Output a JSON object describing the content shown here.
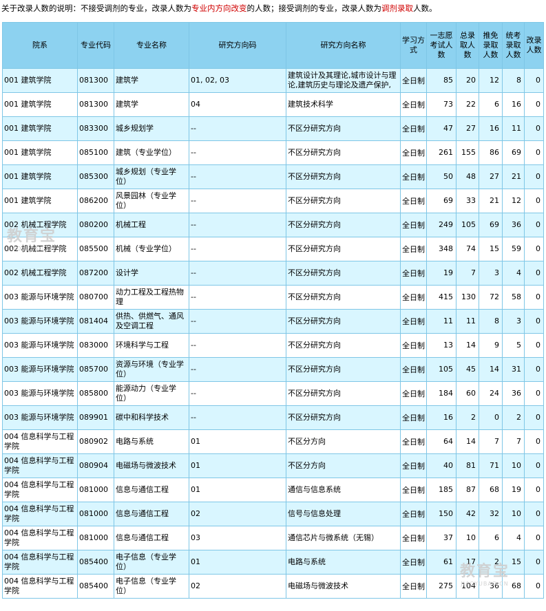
{
  "note": {
    "part1": "关于改录人数的说明：不接受调剂的专业，改录人数为",
    "red1": "专业内方向改变",
    "part2": "的人数；接受调剂的专业，改录人数为",
    "red2": "调剂录取",
    "part3": "人数。",
    "red_color": "#d00000"
  },
  "headers": [
    "院系",
    "专业代码",
    "专业名称",
    "研究方向码",
    "研究方向名称",
    "学习方式",
    "一志愿考试人数",
    "总录取人数",
    "推免录取人数",
    "统考录取人数",
    "改录人数"
  ],
  "rows": [
    [
      "001 建筑学院",
      "081300",
      "建筑学",
      "01, 02, 03",
      "建筑设计及其理论,城市设计与理论,建筑历史与理论及遗产保护,",
      "全日制",
      "85",
      "20",
      "12",
      "8",
      "0"
    ],
    [
      "001 建筑学院",
      "081300",
      "建筑学",
      "04",
      "建筑技术科学",
      "全日制",
      "73",
      "22",
      "6",
      "16",
      "0"
    ],
    [
      "001 建筑学院",
      "083300",
      "城乡规划学",
      "--",
      "不区分研究方向",
      "全日制",
      "47",
      "27",
      "16",
      "11",
      "0"
    ],
    [
      "001 建筑学院",
      "085100",
      "建筑（专业学位）",
      "--",
      "不区分研究方向",
      "全日制",
      "261",
      "155",
      "86",
      "69",
      "0"
    ],
    [
      "001 建筑学院",
      "085300",
      "城乡规划（专业学位）",
      "--",
      "不区分研究方向",
      "全日制",
      "50",
      "48",
      "27",
      "21",
      "0"
    ],
    [
      "001 建筑学院",
      "086200",
      "风景园林（专业学位）",
      "--",
      "不区分研究方向",
      "全日制",
      "69",
      "33",
      "21",
      "12",
      "0"
    ],
    [
      "002 机械工程学院",
      "080200",
      "机械工程",
      "--",
      "不区分研究方向",
      "全日制",
      "249",
      "105",
      "69",
      "36",
      "0"
    ],
    [
      "002 机械工程学院",
      "085500",
      "机械（专业学位）",
      "--",
      "不区分研究方向",
      "全日制",
      "348",
      "74",
      "15",
      "59",
      "0"
    ],
    [
      "002 机械工程学院",
      "087200",
      "设计学",
      "--",
      "不区分研究方向",
      "全日制",
      "19",
      "7",
      "3",
      "4",
      "0"
    ],
    [
      "003 能源与环境学院",
      "080700",
      "动力工程及工程热物理",
      "--",
      "不区分研究方向",
      "全日制",
      "415",
      "130",
      "72",
      "58",
      "0"
    ],
    [
      "003 能源与环境学院",
      "081404",
      "供热、供燃气、通风及空调工程",
      "--",
      "不区分研究方向",
      "全日制",
      "11",
      "11",
      "8",
      "3",
      "0"
    ],
    [
      "003 能源与环境学院",
      "083000",
      "环境科学与工程",
      "--",
      "不区分研究方向",
      "全日制",
      "13",
      "14",
      "9",
      "5",
      "0"
    ],
    [
      "003 能源与环境学院",
      "085700",
      "资源与环境（专业学位）",
      "--",
      "不区分研究方向",
      "全日制",
      "105",
      "45",
      "14",
      "31",
      "0"
    ],
    [
      "003 能源与环境学院",
      "085800",
      "能源动力（专业学位）",
      "--",
      "不区分研究方向",
      "全日制",
      "184",
      "60",
      "24",
      "36",
      "0"
    ],
    [
      "003 能源与环境学院",
      "089901",
      "碳中和科学技术",
      "--",
      "不区分研究方向",
      "全日制",
      "16",
      "2",
      "0",
      "2",
      "0"
    ],
    [
      "004 信息科学与工程学院",
      "080902",
      "电路与系统",
      "01",
      "不区分方向",
      "全日制",
      "64",
      "14",
      "7",
      "7",
      "0"
    ],
    [
      "004 信息科学与工程学院",
      "080904",
      "电磁场与微波技术",
      "01",
      "不区分方向",
      "全日制",
      "40",
      "81",
      "71",
      "10",
      "0"
    ],
    [
      "004 信息科学与工程学院",
      "081000",
      "信息与通信工程",
      "01",
      "通信与信息系统",
      "全日制",
      "185",
      "87",
      "68",
      "19",
      "0"
    ],
    [
      "004 信息科学与工程学院",
      "081000",
      "信息与通信工程",
      "02",
      "信号与信息处理",
      "全日制",
      "150",
      "42",
      "32",
      "10",
      "0"
    ],
    [
      "004 信息科学与工程学院",
      "081000",
      "信息与通信工程",
      "03",
      "通信芯片与微系统（无锡）",
      "全日制",
      "37",
      "10",
      "6",
      "4",
      "0"
    ],
    [
      "004 信息科学与工程学院",
      "085400",
      "电子信息（专业学位）",
      "01",
      "电路与系统",
      "全日制",
      "61",
      "17",
      "2",
      "15",
      "0"
    ],
    [
      "004 信息科学与工程学院",
      "085400",
      "电子信息（专业学位）",
      "02",
      "电磁场与微波技术",
      "全日制",
      "275",
      "104",
      "36",
      "68",
      "0"
    ]
  ],
  "watermark": {
    "text": "教育宝",
    "sub": "JIAOYUBAO.CN"
  }
}
